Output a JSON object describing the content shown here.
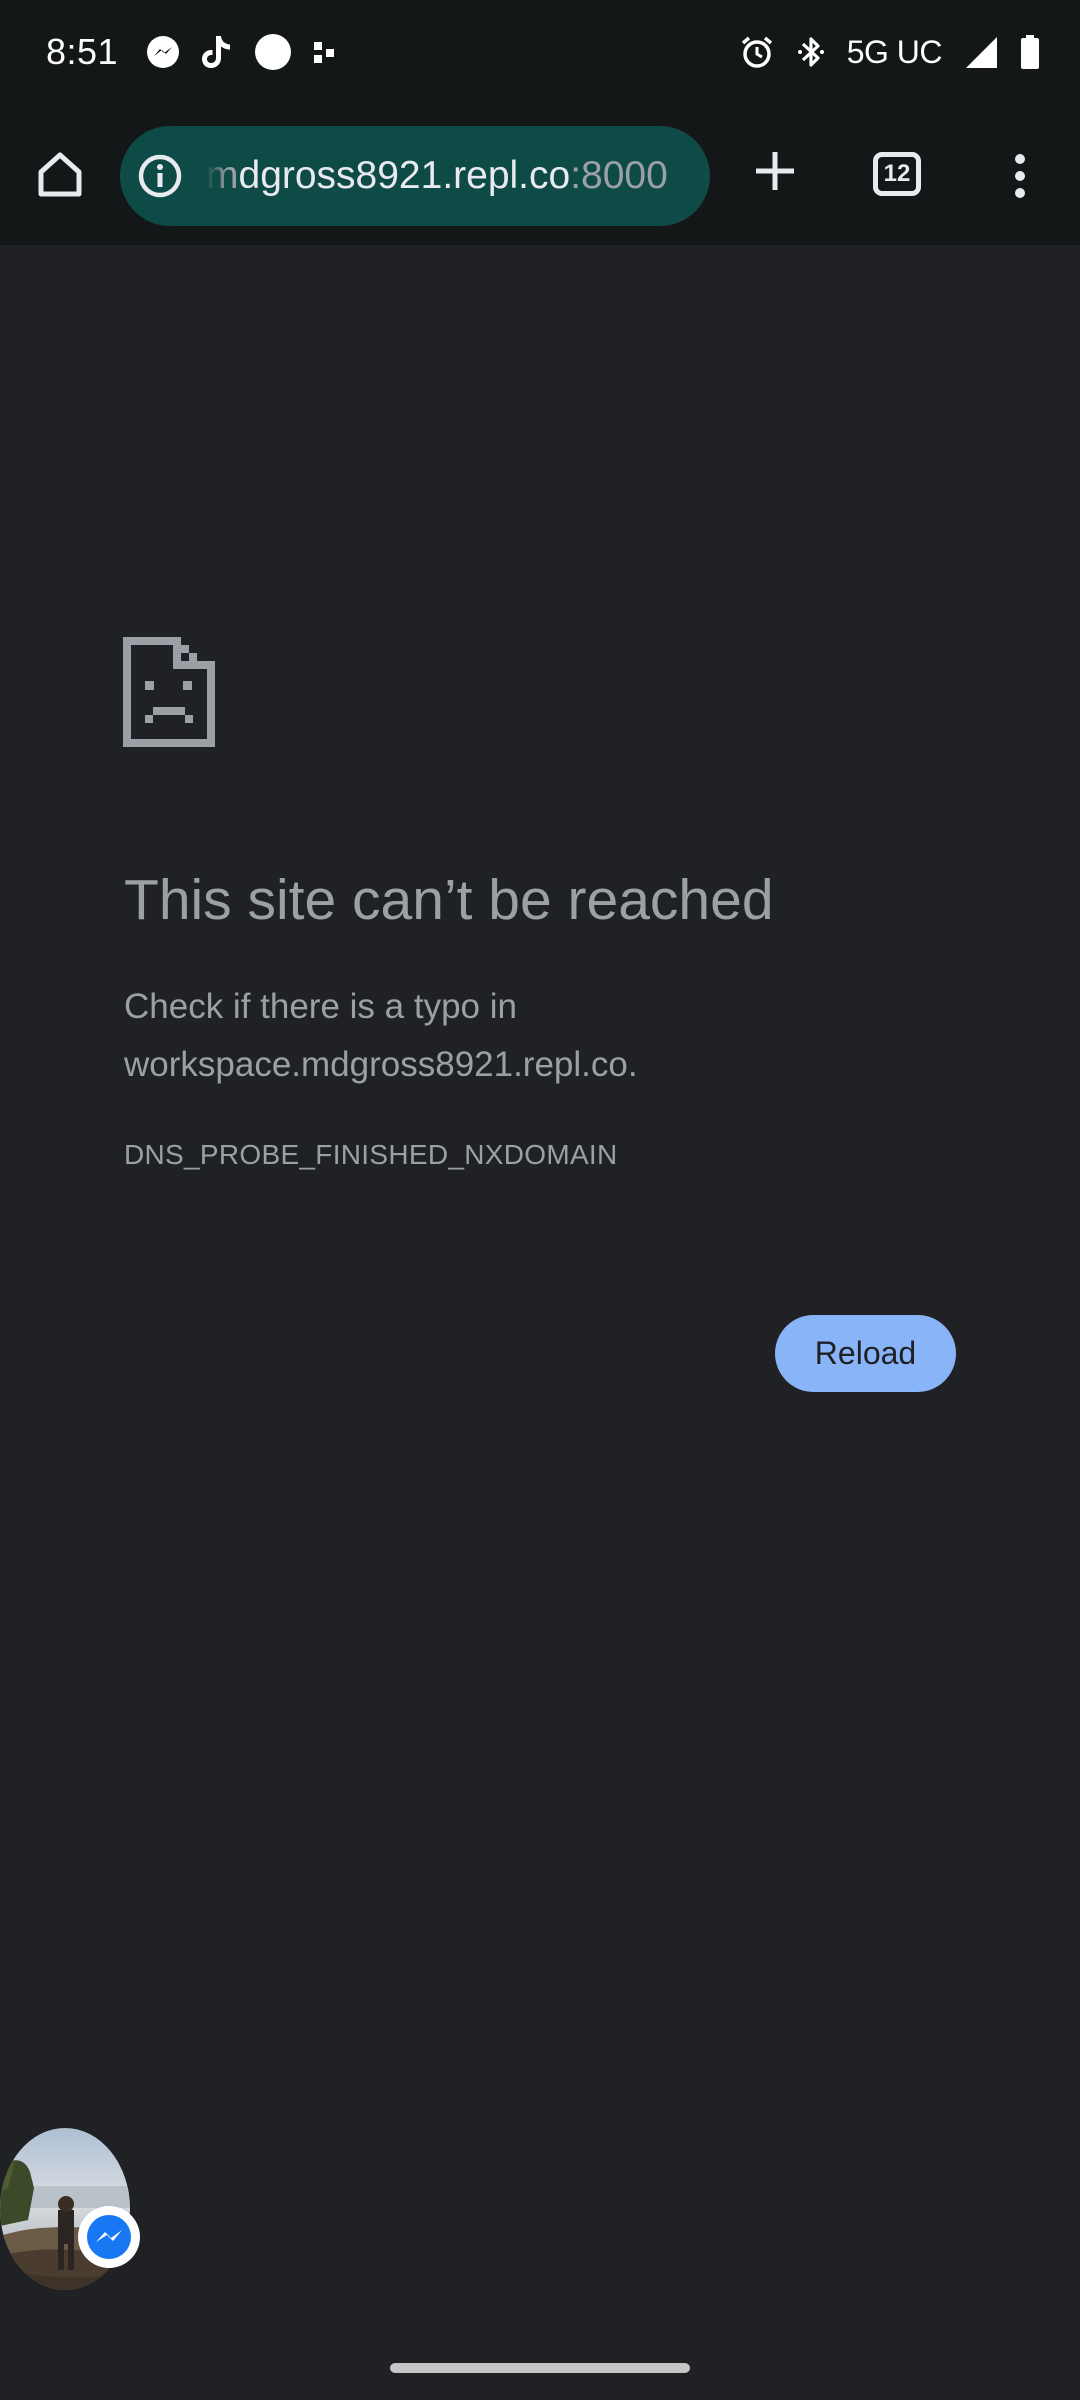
{
  "status_bar": {
    "time": "8:51",
    "network": "5G UC",
    "notification_icons": [
      "messenger-icon",
      "tiktok-icon",
      "circle-app-icon",
      "dots-app-icon"
    ],
    "system_icons": [
      "alarm-icon",
      "bluetooth-icon",
      "signal-icon",
      "battery-icon"
    ]
  },
  "toolbar": {
    "url_prefix": "m",
    "url_host": "dgross8921.repl.co",
    "url_port": ":8000",
    "tab_count": "12",
    "icons": [
      "home-icon",
      "info-icon",
      "plus-icon",
      "tab-switcher-icon",
      "more-vert-icon"
    ]
  },
  "error_page": {
    "icon": "sad-document-icon",
    "title": "This site can’t be reached",
    "description_line1": "Check if there is a typo in",
    "description_line2": "workspace.mdgross8921.repl.co.",
    "error_code": "DNS_PROBE_FINISHED_NXDOMAIN",
    "reload_label": "Reload"
  },
  "chat_head": {
    "icons": [
      "profile-photo",
      "messenger-badge-icon"
    ]
  },
  "colors": {
    "page_background": "#202124",
    "toolbar_background": "#131718",
    "url_bar_background": "#0e4a46",
    "text_secondary": "#9aa0a6",
    "reload_button": "#8ab4f8",
    "messenger_blue": "#1877f2"
  }
}
